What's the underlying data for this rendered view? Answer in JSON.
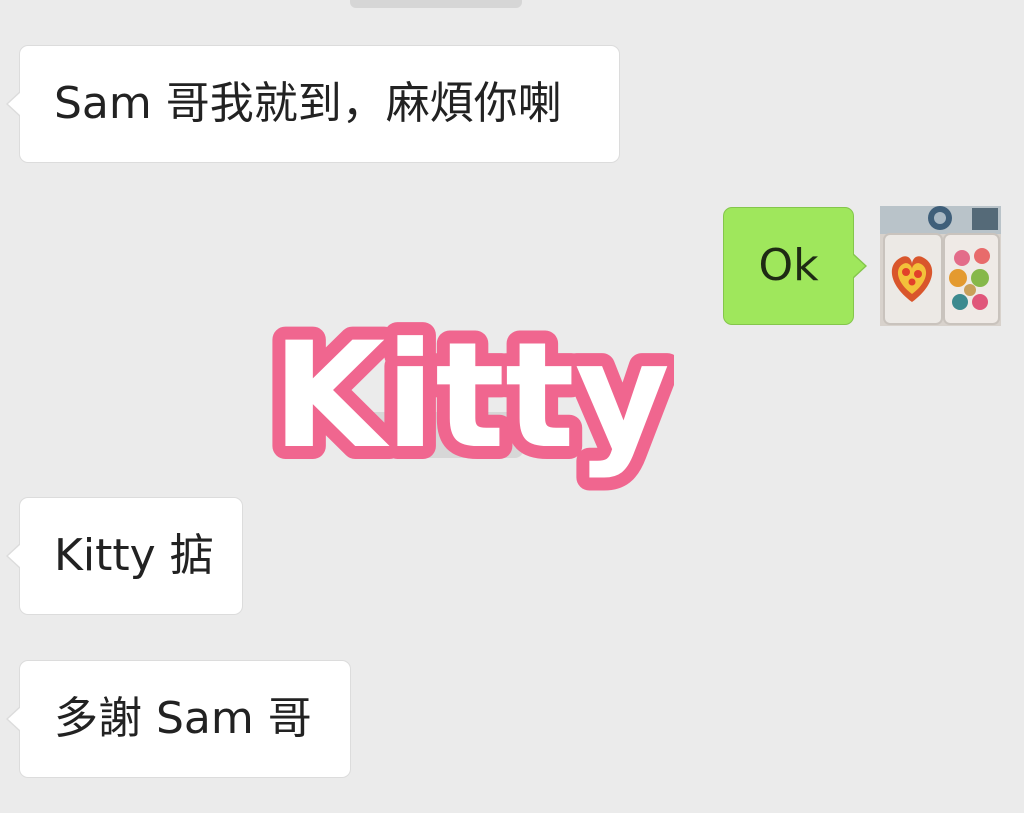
{
  "chat": {
    "messages": [
      {
        "side": "incoming",
        "text": "Sam 哥我就到，麻煩你喇"
      },
      {
        "side": "outgoing",
        "text": "Ok"
      },
      {
        "side": "incoming",
        "text": "Kitty 掂"
      },
      {
        "side": "incoming",
        "text": "多謝 Sam 哥"
      }
    ],
    "watermark": {
      "text": "Kitty",
      "stroke_color": "#f0668f",
      "fill_color": "#ffffff"
    },
    "avatar": {
      "icon": "food-box-avatar"
    }
  },
  "colors": {
    "background": "#ebebeb",
    "incoming_bubble": "#ffffff",
    "outgoing_bubble": "#9fe75c",
    "text": "#222222"
  }
}
